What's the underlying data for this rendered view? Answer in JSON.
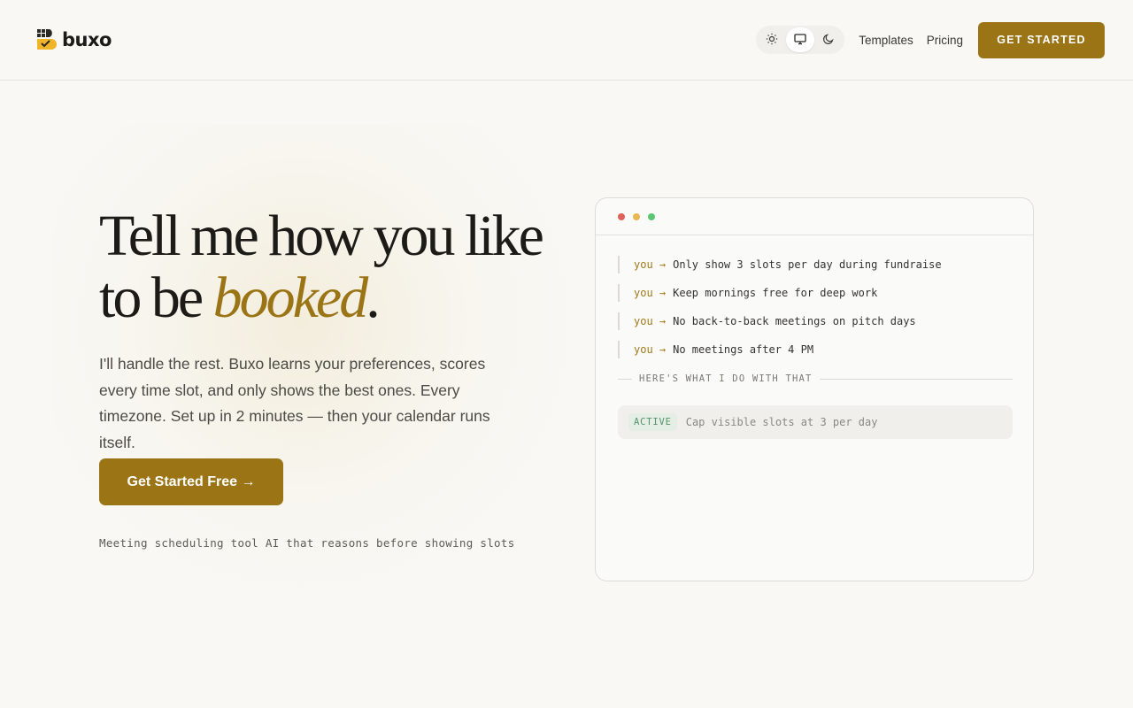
{
  "brand": {
    "name": "buxo",
    "accent_color": "#9b7416",
    "icon": "buxo-logo-icon"
  },
  "nav": {
    "theme_icons": [
      "sun-icon",
      "monitor-icon",
      "moon-icon"
    ],
    "theme_active": "monitor",
    "links": [
      "Templates",
      "Pricing"
    ],
    "cta_label": "GET STARTED"
  },
  "hero": {
    "title_line1": "Tell me how you like",
    "title_line2_prefix": "to be ",
    "title_accent": "booked",
    "title_suffix": ".",
    "description": "I'll handle the rest. Buxo learns your preferences, scores every time slot, and only shows the best ones. Every timezone. Set up in 2 minutes — then your calendar runs itself.",
    "cta_label": "Get Started Free →",
    "footnote": "Meeting scheduling tool AI that reasons before showing slots"
  },
  "terminal": {
    "window_dots": [
      "#e0605a",
      "#e8b850",
      "#5cc870"
    ],
    "rules": [
      {
        "who": "you →",
        "text": "Only show 3 slots per day during fundraise"
      },
      {
        "who": "you →",
        "text": "Keep mornings free for deep work"
      },
      {
        "who": "you →",
        "text": "No back-to-back meetings on pitch days"
      },
      {
        "who": "you →",
        "text": "No meetings after 4 PM"
      }
    ],
    "divider_label": "HERE'S WHAT I DO WITH THAT",
    "active": {
      "badge": "ACTIVE",
      "text": "Cap visible slots at 3 per day"
    }
  }
}
